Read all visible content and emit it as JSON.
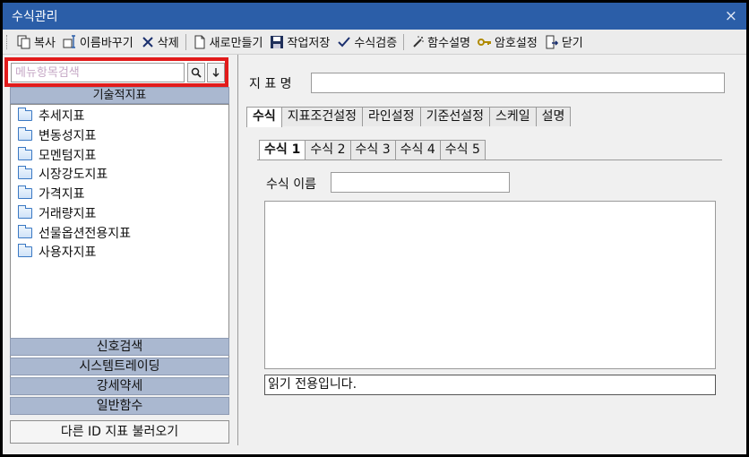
{
  "window": {
    "title": "수식관리",
    "close": "×"
  },
  "toolbar": {
    "copy": "복사",
    "rename": "이름바꾸기",
    "delete": "삭제",
    "new": "새로만들기",
    "save": "작업저장",
    "verify": "수식검증",
    "func_desc": "함수설명",
    "password": "암호설정",
    "close": "닫기"
  },
  "search": {
    "placeholder": "메뉴항목검색",
    "value": ""
  },
  "left": {
    "category_header": "기술적지표",
    "tree_items": [
      "추세지표",
      "변동성지표",
      "모멘텀지표",
      "시장강도지표",
      "가격지표",
      "거래량지표",
      "선물옵션전용지표",
      "사용자지표"
    ],
    "sections": [
      "신호검색",
      "시스템트레이딩",
      "강세약세",
      "일반함수"
    ],
    "load_button": "다른 ID 지표 불러오기"
  },
  "right": {
    "indicator_name_label": "지 표 명",
    "indicator_name_value": "",
    "tabs": [
      "수식",
      "지표조건설정",
      "라인설정",
      "기준선설정",
      "스케일",
      "설명"
    ],
    "active_tab": "수식",
    "subtabs": [
      "수식 1",
      "수식 2",
      "수식 3",
      "수식 4",
      "수식 5"
    ],
    "active_subtab": "수식 1",
    "formula_name_label": "수식 이름",
    "formula_name_value": "",
    "status": "읽기 전용입니다."
  },
  "icons": {
    "copy": "copy-icon",
    "rename": "rename-icon",
    "delete": "delete-icon",
    "new": "new-document-icon",
    "save": "floppy-disk-icon",
    "verify": "checkmark-icon",
    "func_desc": "magic-wand-icon",
    "password": "key-icon",
    "close": "exit-door-icon",
    "search": "search-icon",
    "down": "arrow-down-icon"
  },
  "colors": {
    "titlebar": "#2b5ea8",
    "highlight": "#e21b1b",
    "section_bar": "#aab8d0"
  }
}
